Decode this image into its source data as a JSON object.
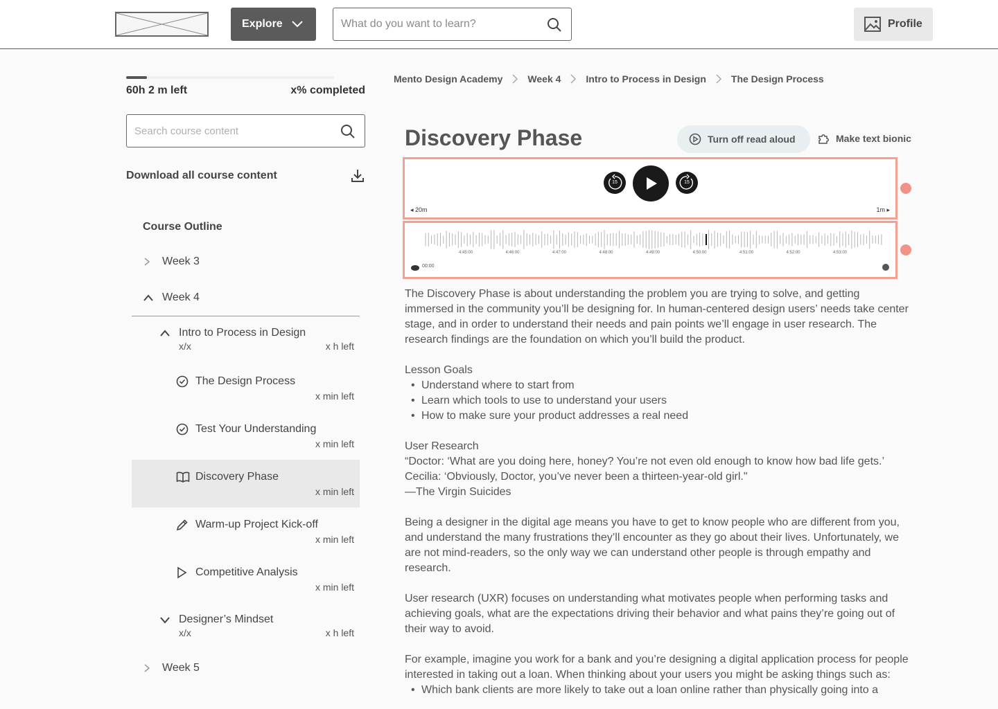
{
  "header": {
    "explore_label": "Explore",
    "search_placeholder": "What do you want to learn?",
    "profile_label": "Profile"
  },
  "sidebar": {
    "progress_fraction": 0.1,
    "time_left": "60h 2 m left",
    "percent_completed": "x% completed",
    "search_placeholder": "Search course content",
    "download_label": "Download all course content",
    "outline_title": "Course Outline",
    "week3": "Week 3",
    "week4": "Week 4",
    "week5": "Week 5",
    "section_intro": {
      "title": "Intro to Process in Design",
      "count": "x/x",
      "left": "x h left"
    },
    "lessons": [
      {
        "title": "The Design Process",
        "left": "x min left",
        "icon": "check-circle-icon"
      },
      {
        "title": "Test Your Understanding",
        "left": "x min left",
        "icon": "check-circle-icon"
      },
      {
        "title": "Discovery Phase",
        "left": "x min left",
        "icon": "book-icon"
      },
      {
        "title": "Warm-up Project Kick-off",
        "left": "x min left",
        "icon": "pencil-icon"
      },
      {
        "title": "Competitive Analysis",
        "left": "x min left",
        "icon": "play-icon"
      }
    ],
    "section_mindset": {
      "title": "Designer’s Mindset",
      "count": "x/x",
      "left": "x h left"
    }
  },
  "breadcrumb": [
    "Mento Design Academy",
    "Week 4",
    "Intro to Process in Design",
    "The Design Process"
  ],
  "page_title": "Discovery Phase",
  "read_aloud_label": "Turn off read aloud",
  "bionic_label": "Make text bionic",
  "player": {
    "rewind_label": "15",
    "forward_label": "15",
    "left_time": "20m",
    "right_time": "1m"
  },
  "waveform": {
    "ticks": [
      "4:45:00",
      "4:46:00",
      "4:47:00",
      "4:48:00",
      "4:49:00",
      "4:50:00",
      "4:51:00",
      "4:52:00",
      "4:53:00"
    ],
    "current_time": "00:00"
  },
  "article": {
    "intro": "The Discovery Phase is about understanding the problem you are trying to solve, and getting immersed in the community you’ll be designing for. In human-centered design users’ needs take center stage, and in order to understand their needs and pain points we’ll engage in user research. The research findings are the foundation on which you’ll build the product.",
    "goals_title": "Lesson Goals",
    "goals": [
      "Understand where to start from",
      "Learn which tools to use to understand your users",
      "How to make sure your product addresses a real need"
    ],
    "research_title": "User Research",
    "quote_1": "“Doctor: ‘What are you doing here, honey? You’re not even old enough to know how bad life gets.’",
    "quote_2": "Cecilia: ‘Obviously, Doctor, you’ve never been a thirteen-year-old girl.\"",
    "quote_3": "—The Virgin Suicides",
    "para_2": "Being a designer in the digital age means you have to get to know people who are different from you, and understand the many frustrations they’ll encounter as they go about their lives. Unfortunately, we are not mind-readers, so the only way we can understand other people is through empathy and research.",
    "para_3": "User research (UXR) focuses on understanding what motivates people when performing tasks and achieving goals, what are the expectations driving their behavior and what pains they’re going out of their way to avoid.",
    "para_4": "For example, imagine you work for a bank and you’re designing a digital application process for people interested in taking out a loan. When thinking about your users you might be asking things such as:",
    "bullet_cut": "Which bank clients are more likely to take out a loan online rather than physically going into a"
  }
}
